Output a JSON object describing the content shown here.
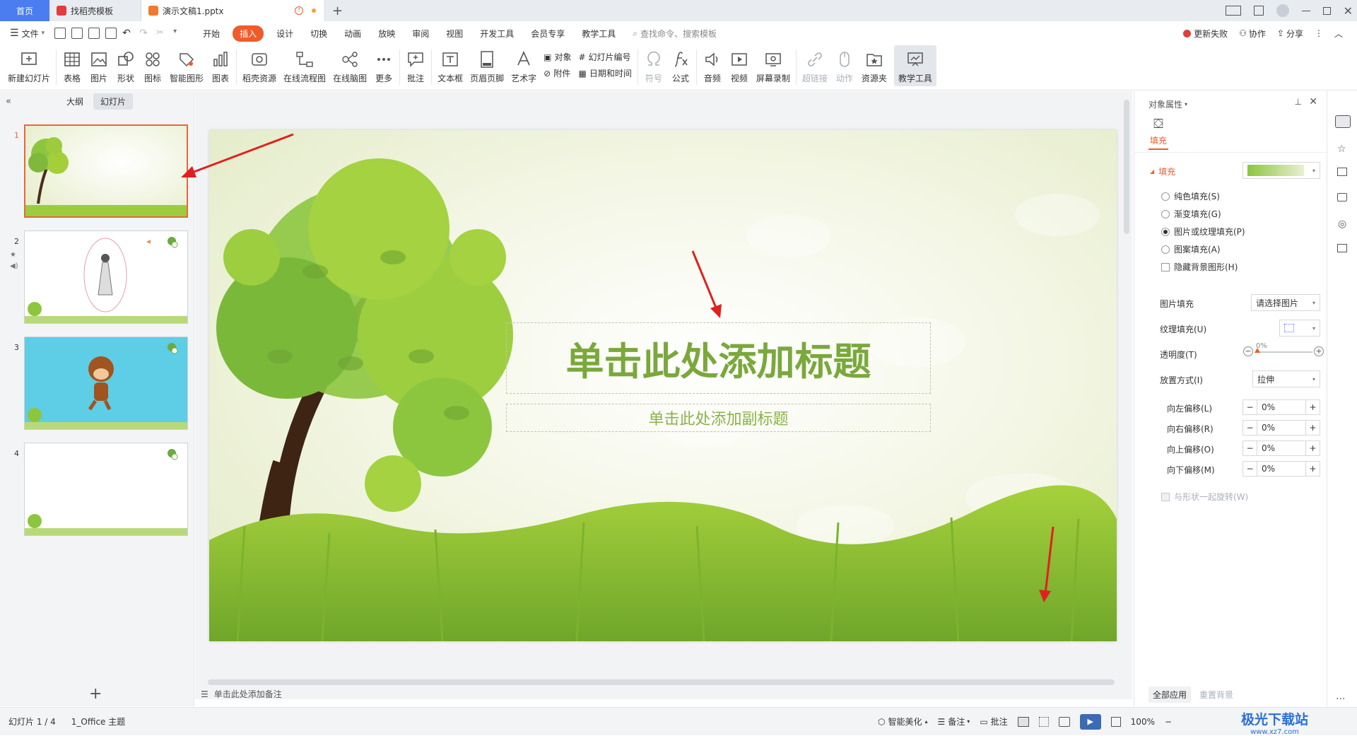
{
  "tabs": {
    "home": "首页",
    "template": "找稻壳模板",
    "doc": "演示文稿1.pptx"
  },
  "menu": {
    "file": "文件",
    "items": [
      "开始",
      "插入",
      "设计",
      "切换",
      "动画",
      "放映",
      "审阅",
      "视图",
      "开发工具",
      "会员专享",
      "教学工具"
    ],
    "active_index": 1,
    "search_placeholder": "查找命令、搜索模板",
    "update_failed": "更新失败",
    "collab": "协作",
    "share": "分享"
  },
  "ribbon": {
    "new_slide": "新建幻灯片",
    "table": "表格",
    "picture": "图片",
    "shape": "形状",
    "icon": "图标",
    "smart_art": "智能图形",
    "chart": "图表",
    "docer_resource": "稻壳资源",
    "online_flowchart": "在线流程图",
    "online_mindmap": "在线脑图",
    "more": "更多",
    "comment": "批注",
    "textbox": "文本框",
    "header_footer": "页眉页脚",
    "wordart": "艺术字",
    "object": "对象",
    "slide_number": "幻灯片编号",
    "attachment": "附件",
    "date_time": "日期和时间",
    "symbol": "符号",
    "formula": "公式",
    "audio": "音频",
    "video": "视频",
    "screen_record": "屏幕录制",
    "hyperlink": "超链接",
    "action": "动作",
    "resource_folder": "资源夹",
    "teaching_tools": "教学工具"
  },
  "left_panel": {
    "tab_outline": "大纲",
    "tab_slides": "幻灯片",
    "slide_numbers": [
      "1",
      "2",
      "3",
      "4"
    ]
  },
  "slide": {
    "title_placeholder": "单击此处添加标题",
    "subtitle_placeholder": "单击此处添加副标题"
  },
  "notes_placeholder": "单击此处添加备注",
  "right_panel": {
    "header": "对象属性",
    "tab_fill": "填充",
    "section_fill": "填充",
    "options": [
      "纯色填充(S)",
      "渐变填充(G)",
      "图片或纹理填充(P)",
      "图案填充(A)"
    ],
    "selected_option": 2,
    "hide_bg_graphics": "隐藏背景图形(H)",
    "picture_fill_label": "图片填充",
    "picture_fill_value": "请选择图片",
    "texture_fill_label": "纹理填充(U)",
    "transparency_label": "透明度(T)",
    "transparency_value": "0%",
    "placement_label": "放置方式(I)",
    "placement_value": "拉伸",
    "offsets": [
      {
        "label": "向左偏移(L)",
        "value": "0%"
      },
      {
        "label": "向右偏移(R)",
        "value": "0%"
      },
      {
        "label": "向上偏移(O)",
        "value": "0%"
      },
      {
        "label": "向下偏移(M)",
        "value": "0%"
      }
    ],
    "rotate_with_shape": "与形状一起旋转(W)",
    "apply_all": "全部应用",
    "reset_bg": "重置背景"
  },
  "status": {
    "slide_count": "幻灯片 1 / 4",
    "theme": "1_Office 主题",
    "smart_beautify": "智能美化",
    "notes": "备注",
    "comments": "批注",
    "zoom": "100%",
    "watermark": "极光下载站",
    "watermark_url": "www.xz7.com"
  },
  "colors": {
    "accent": "#ef5b2b",
    "home_tab": "#4b7cf0",
    "title_green": "#7aa83c",
    "subtitle_green": "#8bb24a"
  }
}
